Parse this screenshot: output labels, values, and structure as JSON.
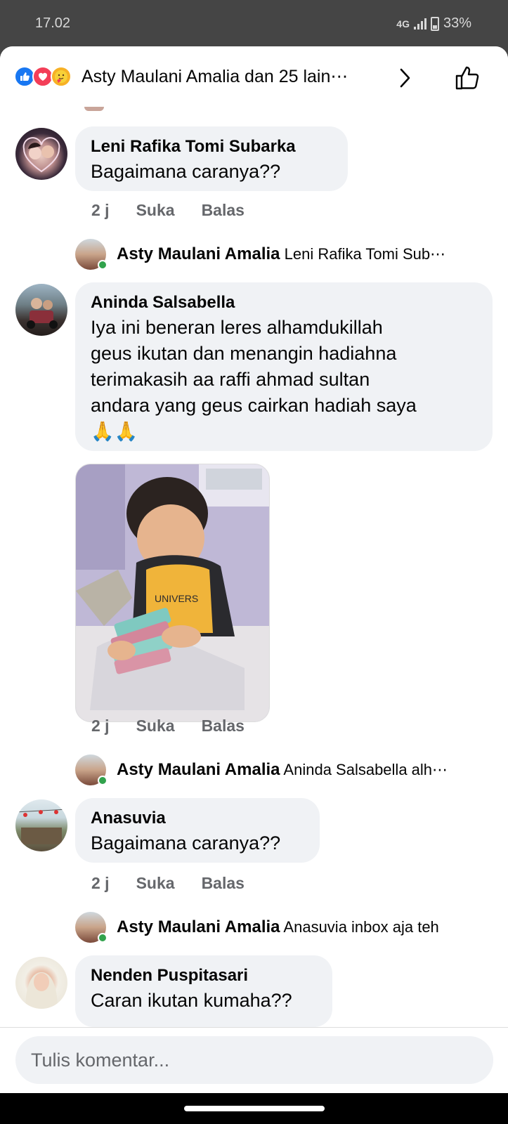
{
  "status_bar": {
    "time": "17.02",
    "network": "4G",
    "battery": "33%"
  },
  "header": {
    "reactions": [
      "like-icon",
      "love-icon",
      "care-icon"
    ],
    "title": "Asty Maulani Amalia dan 25 lain⋯"
  },
  "comments": [
    {
      "author": "Leni Rafika Tomi Subarka",
      "text": "Bagaimana caranya??",
      "time": "2 j",
      "like": "Suka",
      "reply": "Balas",
      "reply_preview": {
        "author": "Asty Maulani Amalia",
        "text": "Leni Rafika Tomi Sub⋯"
      }
    },
    {
      "author": "Aninda Salsabella",
      "text_lines": [
        "Iya ini beneran leres alhamdukillah",
        "geus ikutan dan menangin hadiahna",
        "terimakasih aa raffi ahmad sultan",
        "andara yang geus cairkan hadiah saya",
        "🙏🙏"
      ],
      "time": "2 j",
      "like": "Suka",
      "reply": "Balas",
      "reply_preview": {
        "author": "Asty Maulani Amalia",
        "text": "Aninda Salsabella alh⋯"
      }
    },
    {
      "author": "Anasuvia",
      "text": "Bagaimana caranya??",
      "time": "2 j",
      "like": "Suka",
      "reply": "Balas",
      "reply_preview": {
        "author": "Asty Maulani Amalia",
        "text": "Anasuvia inbox aja teh"
      }
    },
    {
      "author": "Nenden Puspitasari",
      "text": "Caran ikutan kumaha??"
    }
  ],
  "composer": {
    "placeholder": "Tulis komentar..."
  },
  "colors": {
    "like": "#1877f2",
    "love": "#f33e58",
    "online": "#31a24c",
    "bubble": "#f0f2f5"
  }
}
